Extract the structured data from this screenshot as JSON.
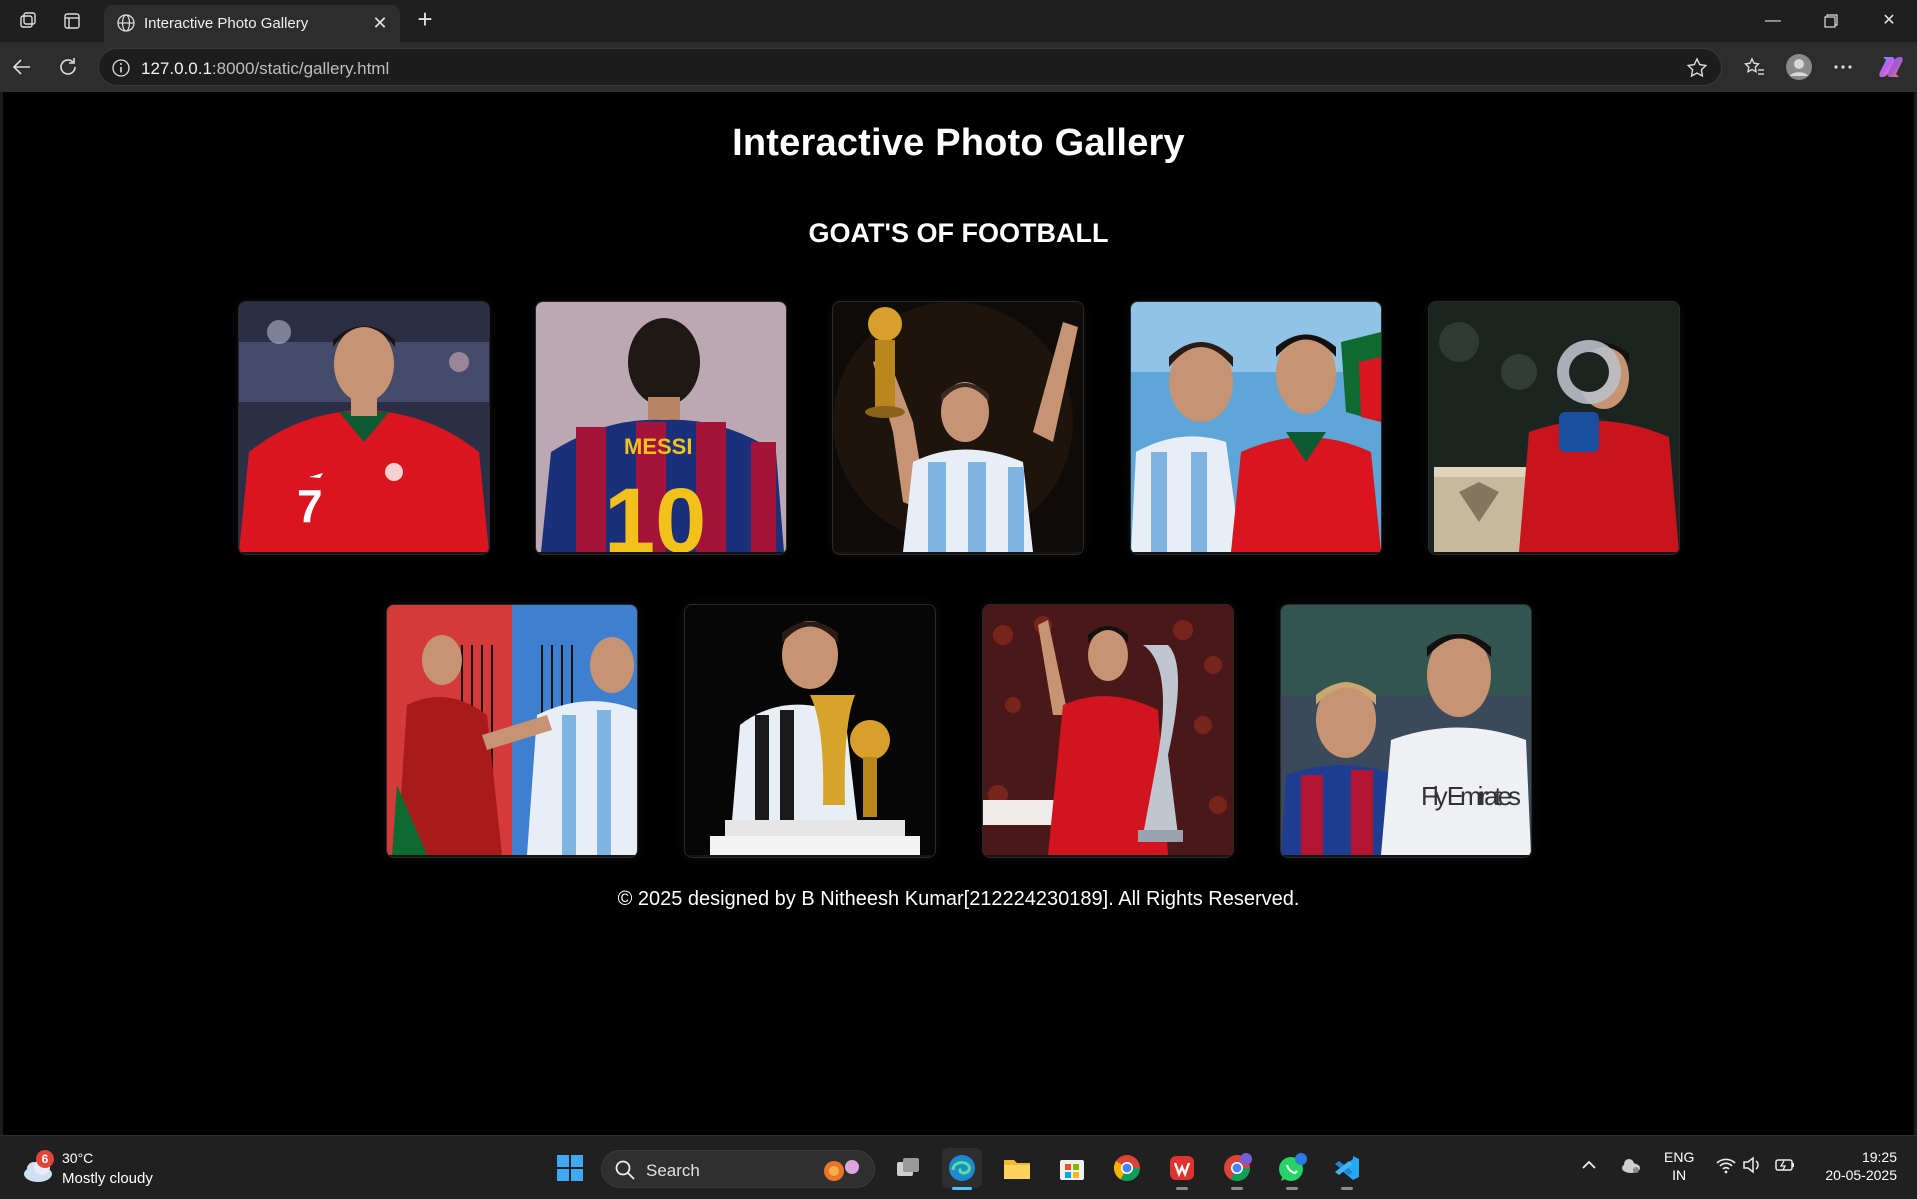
{
  "browser": {
    "tab_title": "Interactive Photo Gallery",
    "url_host": "127.0.0.1",
    "url_rest": ":8000/static/gallery.html"
  },
  "page": {
    "title": "Interactive Photo Gallery",
    "subtitle": "GOAT'S OF FOOTBALL",
    "footer": "© 2025 designed by B Nitheesh Kumar[212224230189]. All Rights Reserved.",
    "photos": [
      {
        "name": "photo-ronaldo-portugal-7"
      },
      {
        "name": "photo-messi-barcelona-back-10",
        "jersey_text": "MESSI",
        "number": "10"
      },
      {
        "name": "photo-messi-golden-ball"
      },
      {
        "name": "photo-messi-ronaldo-flags"
      },
      {
        "name": "photo-ronaldo-nations-league-trophy"
      },
      {
        "name": "photo-ronaldo-messi-split"
      },
      {
        "name": "photo-messi-kissing-world-cup"
      },
      {
        "name": "photo-ronaldo-trophy-celebration"
      },
      {
        "name": "photo-messi-ronaldo-together",
        "shirt_text": "Fly Emirates"
      }
    ]
  },
  "taskbar": {
    "weather_temp": "30°C",
    "weather_desc": "Mostly cloudy",
    "weather_badge": "6",
    "search_label": "Search",
    "lang_line1": "ENG",
    "lang_line2": "IN",
    "time": "19:25",
    "date": "20-05-2025",
    "whatsapp_badge": "4",
    "chrome_badge": "N"
  },
  "colors": {
    "page_bg": "#000000",
    "text": "#ffffff",
    "accent": "#4cc2ff"
  }
}
